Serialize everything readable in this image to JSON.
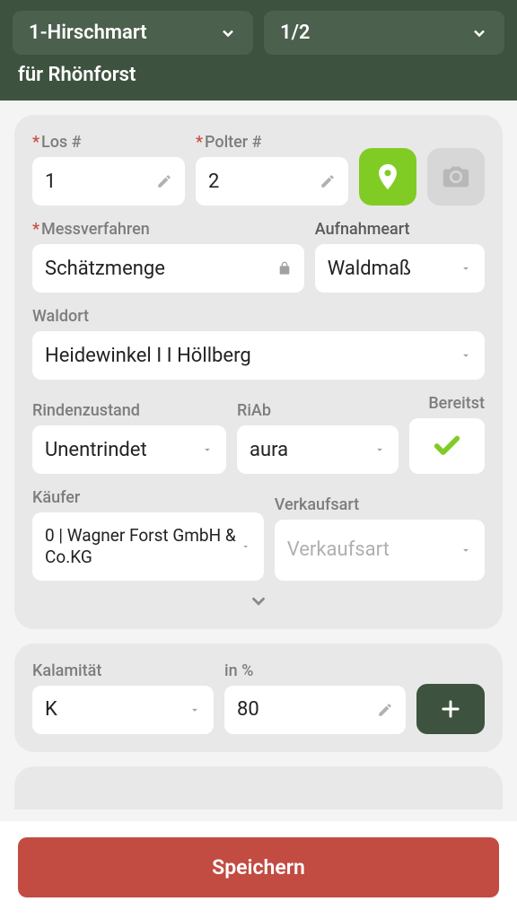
{
  "header": {
    "select1": "1-Hirschmart",
    "select2": "1/2",
    "subhead": "für Rhönforst"
  },
  "card1": {
    "los_label": "Los #",
    "los_value": "1",
    "polter_label": "Polter #",
    "polter_value": "2",
    "messverfahren_label": "Messverfahren",
    "messverfahren_value": "Schätzmenge",
    "aufnahmeart_label": "Aufnahmeart",
    "aufnahmeart_value": "Waldmaß",
    "waldort_label": "Waldort",
    "waldort_value": "Heidewinkel I I Höllberg",
    "rindenzustand_label": "Rindenzustand",
    "rindenzustand_value": "Unentrindet",
    "riab_label": "RiAb",
    "riab_value": "aura",
    "bereitst_label": "Bereitst",
    "kaeufer_label": "Käufer",
    "kaeufer_value": "0 |  Wagner Forst GmbH & Co.KG",
    "verkaufsart_label": "Verkaufsart",
    "verkaufsart_placeholder": "Verkaufsart"
  },
  "card2": {
    "kalamitaet_label": "Kalamität",
    "kalamitaet_value": "K",
    "percent_label": "in %",
    "percent_value": "80"
  },
  "save_label": "Speichern"
}
